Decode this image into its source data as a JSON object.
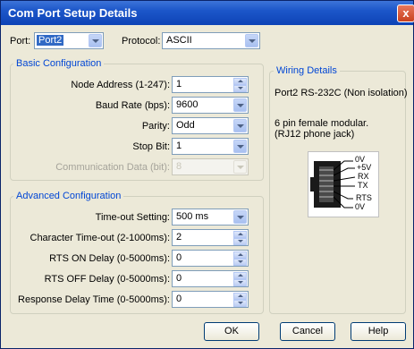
{
  "window": {
    "title": "Com Port Setup Details",
    "close_glyph": "x"
  },
  "top": {
    "port_label": "Port:",
    "port_value": "Port2",
    "protocol_label": "Protocol:",
    "protocol_value": "ASCII"
  },
  "basic": {
    "title": "Basic Configuration",
    "node_address_label": "Node Address (1-247):",
    "node_address_value": "1",
    "baud_label": "Baud Rate (bps):",
    "baud_value": "9600",
    "parity_label": "Parity:",
    "parity_value": "Odd",
    "stopbit_label": "Stop Bit:",
    "stopbit_value": "1",
    "commdata_label": "Communication Data (bit):",
    "commdata_value": "8"
  },
  "advanced": {
    "title": "Advanced Configuration",
    "timeout_label": "Time-out Setting:",
    "timeout_value": "500 ms",
    "char_timeout_label": "Character Time-out (2-1000ms):",
    "char_timeout_value": "2",
    "rts_on_label": "RTS ON Delay (0-5000ms):",
    "rts_on_value": "0",
    "rts_off_label": "RTS OFF Delay (0-5000ms):",
    "rts_off_value": "0",
    "resp_delay_label": "Response Delay Time (0-5000ms):",
    "resp_delay_value": "0"
  },
  "wiring": {
    "title": "Wiring Details",
    "port_desc": "Port2 RS-232C (Non isolation)",
    "jack_line1": "6 pin female modular.",
    "jack_line2": "(RJ12 phone jack)",
    "pins": [
      "0V",
      "+5V",
      "RX",
      "TX",
      "RTS",
      "0V"
    ]
  },
  "buttons": {
    "ok": "OK",
    "cancel": "Cancel",
    "help": "Help"
  },
  "colors": {
    "title_bar": "#1c56c9",
    "group_title": "#0046d5",
    "window_bg": "#ece9d8"
  }
}
